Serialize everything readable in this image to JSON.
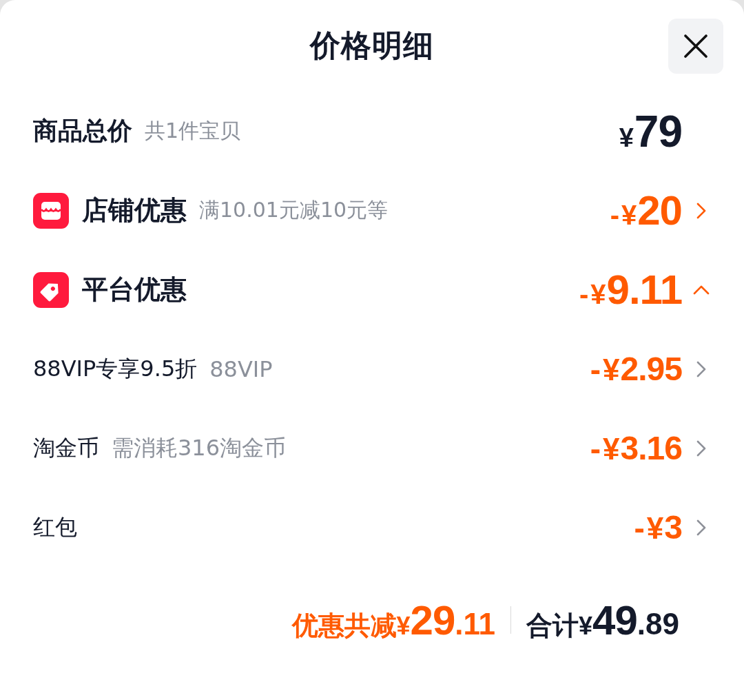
{
  "header": {
    "title": "价格明细"
  },
  "subtotal": {
    "label": "商品总价",
    "note": "共1件宝贝",
    "currency": "¥",
    "amount": "79"
  },
  "discounts": [
    {
      "kind": "store",
      "label": "店铺优惠",
      "note": "满10.01元减10元等",
      "sign": "-",
      "currency": "¥",
      "amount": "20",
      "expanded": false
    },
    {
      "kind": "platform",
      "label": "平台优惠",
      "sign": "-",
      "currency": "¥",
      "amount": "9.11",
      "expanded": true,
      "children": [
        {
          "label": "88VIP专享9.5折",
          "note": "88VIP",
          "sign": "-",
          "currency": "¥",
          "amount": "2.95"
        },
        {
          "label": "淘金币",
          "note": "需消耗316淘金币",
          "sign": "-",
          "currency": "¥",
          "amount": "3.16"
        },
        {
          "label": "红包",
          "sign": "-",
          "currency": "¥",
          "amount": "3"
        }
      ]
    }
  ],
  "footer": {
    "saving": {
      "label": "优惠共减",
      "currency": "¥",
      "amount": "29",
      "decimal": ".11"
    },
    "total": {
      "label": "合计",
      "currency": "¥",
      "amount": "49",
      "decimal": ".89"
    }
  }
}
